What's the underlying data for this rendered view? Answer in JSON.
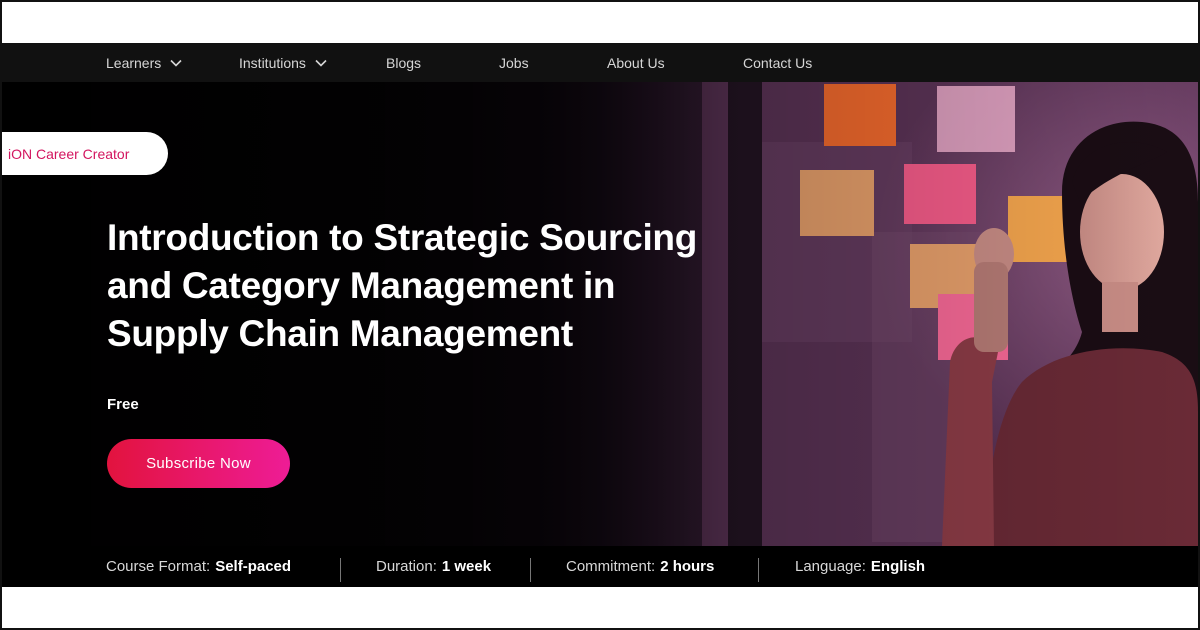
{
  "nav": {
    "items": [
      {
        "label": "Learners",
        "has_dropdown": true
      },
      {
        "label": "Institutions",
        "has_dropdown": true
      },
      {
        "label": "Blogs",
        "has_dropdown": false
      },
      {
        "label": "Jobs",
        "has_dropdown": false
      },
      {
        "label": "About Us",
        "has_dropdown": false
      },
      {
        "label": "Contact Us",
        "has_dropdown": false
      }
    ]
  },
  "hero": {
    "badge": "iON Career Creator",
    "title_lines": [
      "Introduction to Strategic Sourcing",
      "and Category Management in",
      "Supply Chain Management"
    ],
    "price": "Free",
    "cta_label": "Subscribe Now"
  },
  "course_info": [
    {
      "label": "Course Format:",
      "value": "Self-paced"
    },
    {
      "label": "Duration:",
      "value": "1 week"
    },
    {
      "label": "Commitment:",
      "value": "2 hours"
    },
    {
      "label": "Language:",
      "value": "English"
    }
  ],
  "colors": {
    "nav_bg": "#111111",
    "badge_text": "#d3155f",
    "cta_start": "#e2133e",
    "cta_end": "#ee1c96",
    "hero_bg": "#050305"
  }
}
